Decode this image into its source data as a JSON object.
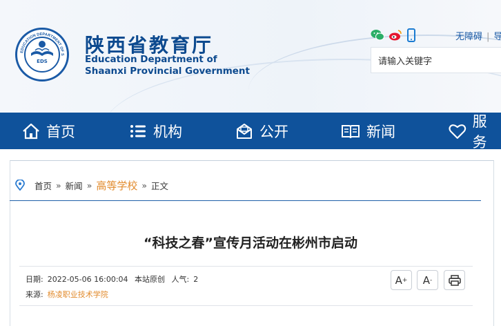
{
  "header": {
    "title_cn": "陕西省教育厅",
    "title_en_line1": "Education Department of",
    "title_en_line2": "Shaanxi Provincial Government",
    "logo_ring_text": "EDUCATION DEPARTMENT OF SHAANXI",
    "logo_center": "EDS",
    "logo_bottom_text": "陕西省教育厅",
    "accessibility_link": "无障碍",
    "separator": "|",
    "next_link_fragment": "导",
    "social_icons": [
      "wechat-icon",
      "weibo-icon",
      "mobile-icon"
    ],
    "social_colors": {
      "wechat": "#2aae67",
      "weibo": "#e6162d",
      "mobile": "#1a7bd1"
    }
  },
  "search": {
    "placeholder": "请输入关键字"
  },
  "nav": {
    "items": [
      {
        "label": "首页",
        "icon": "home-icon"
      },
      {
        "label": "机构",
        "icon": "list-icon"
      },
      {
        "label": "公开",
        "icon": "envelope-icon"
      },
      {
        "label": "新闻",
        "icon": "book-icon"
      },
      {
        "label": "服务",
        "icon": "heart-icon"
      }
    ],
    "background": "#0f529b"
  },
  "breadcrumb": {
    "icon": "location-pin-icon",
    "home": "首页",
    "news": "新闻",
    "current_section": "高等学校",
    "page": "正文",
    "arrow": "»"
  },
  "article": {
    "title": "“科技之春”宣传月活动在彬州市启动",
    "date_label": "日期:",
    "date": "2022-05-06 16:00:04",
    "origin": "本站原创",
    "views_label": "人气:",
    "views": "2",
    "source_label": "来源:",
    "source": "杨凌职业技术学院"
  },
  "tools": {
    "font_larger": "A",
    "font_larger_sup": "+",
    "font_smaller": "A",
    "font_smaller_sup": "-",
    "print_icon": "printer-icon"
  }
}
